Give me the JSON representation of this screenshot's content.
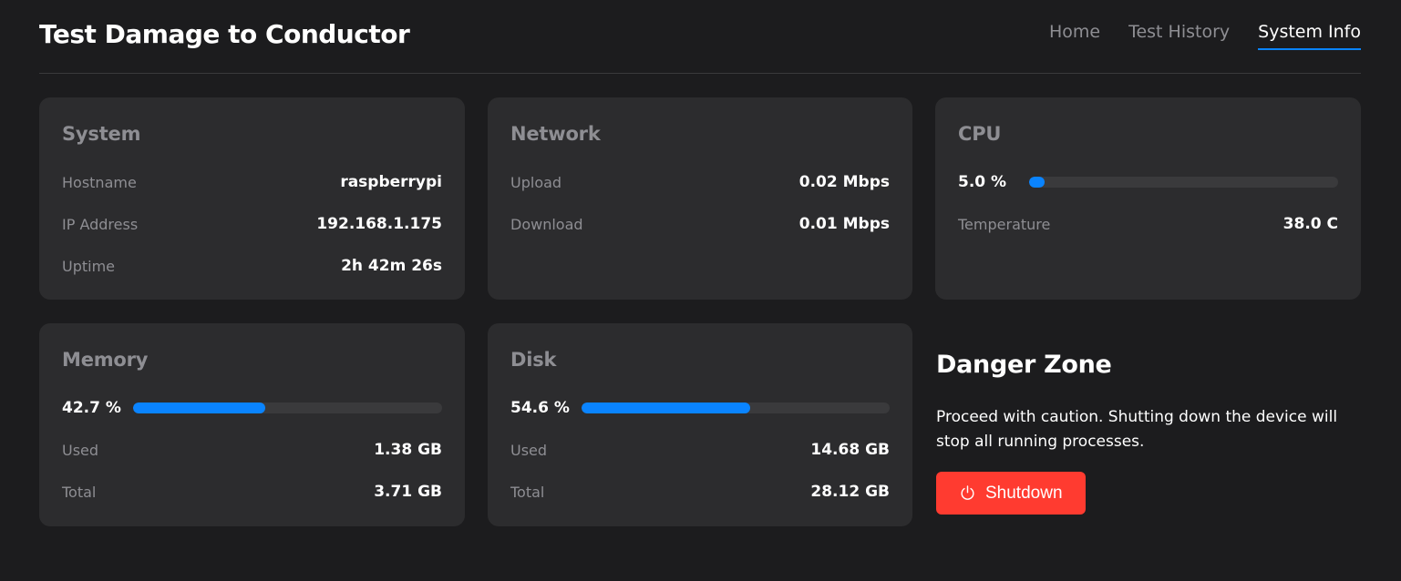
{
  "header": {
    "title": "Test Damage to Conductor",
    "nav": [
      {
        "label": "Home",
        "active": false
      },
      {
        "label": "Test History",
        "active": false
      },
      {
        "label": "System Info",
        "active": true
      }
    ]
  },
  "system": {
    "title": "System",
    "rows": [
      {
        "label": "Hostname",
        "value": "raspberrypi"
      },
      {
        "label": "IP Address",
        "value": "192.168.1.175"
      },
      {
        "label": "Uptime",
        "value": "2h 42m 26s"
      }
    ]
  },
  "network": {
    "title": "Network",
    "rows": [
      {
        "label": "Upload",
        "value": "0.02 Mbps"
      },
      {
        "label": "Download",
        "value": "0.01 Mbps"
      }
    ]
  },
  "cpu": {
    "title": "CPU",
    "usage_label": "5.0 %",
    "usage_percent": 5.0,
    "rows": [
      {
        "label": "Temperature",
        "value": "38.0 C"
      }
    ]
  },
  "memory": {
    "title": "Memory",
    "usage_label": "42.7 %",
    "usage_percent": 42.7,
    "rows": [
      {
        "label": "Used",
        "value": "1.38 GB"
      },
      {
        "label": "Total",
        "value": "3.71 GB"
      }
    ]
  },
  "disk": {
    "title": "Disk",
    "usage_label": "54.6 %",
    "usage_percent": 54.6,
    "rows": [
      {
        "label": "Used",
        "value": "14.68 GB"
      },
      {
        "label": "Total",
        "value": "28.12 GB"
      }
    ]
  },
  "danger_zone": {
    "title": "Danger Zone",
    "text": "Proceed with caution. Shutting down the device will stop all running processes.",
    "button_label": "Shutdown",
    "button_icon": "power-icon"
  },
  "colors": {
    "background": "#1c1c1e",
    "card": "#2c2c2e",
    "accent": "#0a84ff",
    "danger": "#ff3b30",
    "muted": "#8e8e93"
  }
}
